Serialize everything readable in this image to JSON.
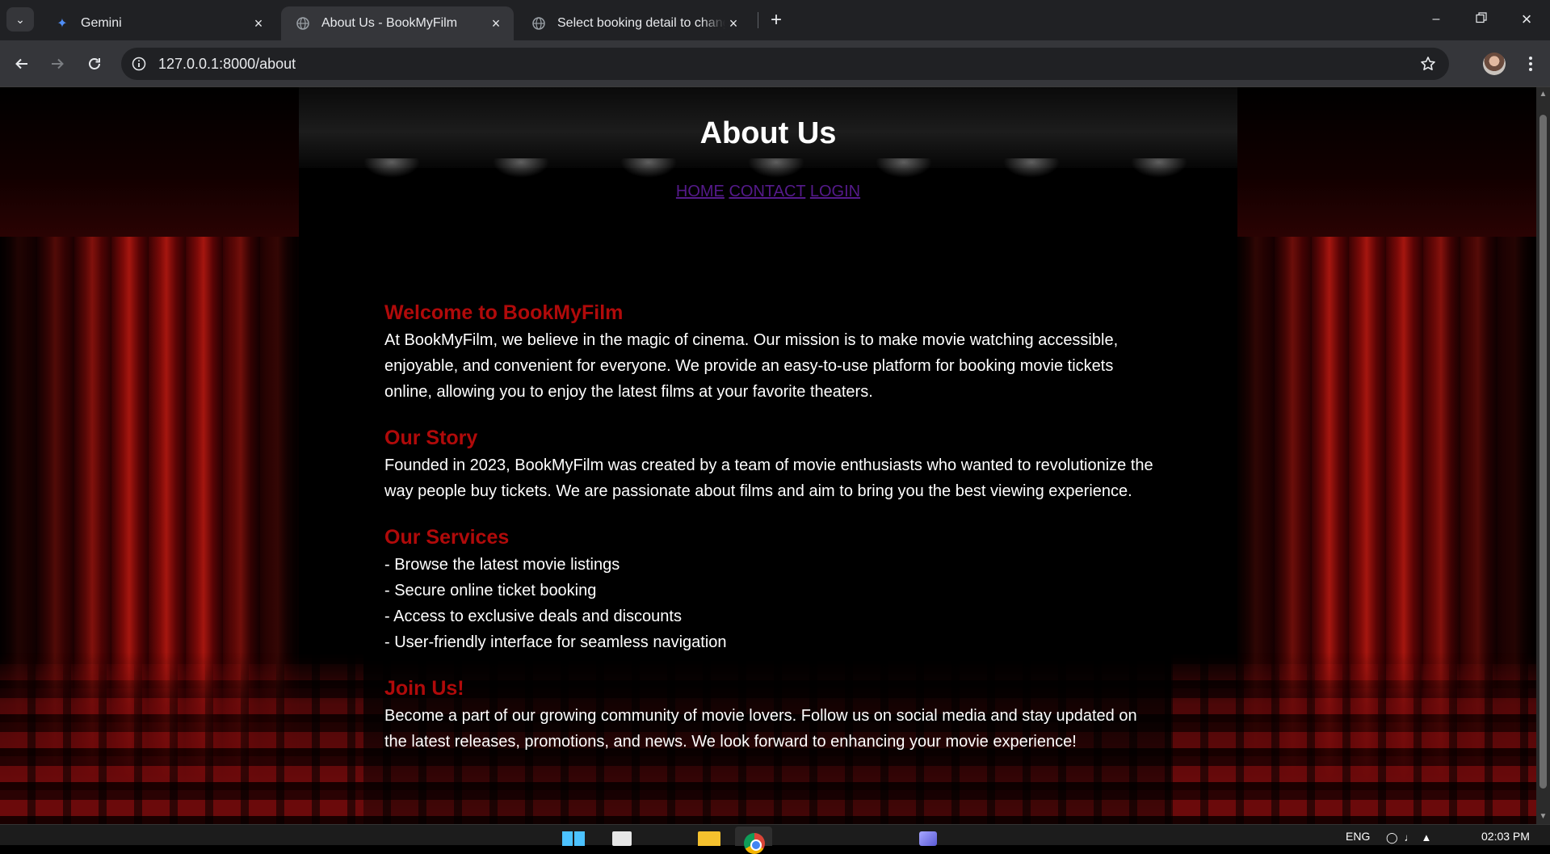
{
  "browser": {
    "tabs": [
      {
        "title": "Gemini",
        "icon": "gemini-sparkle-icon",
        "active": false
      },
      {
        "title": "About Us - BookMyFilm",
        "icon": "globe-icon",
        "active": true
      },
      {
        "title": "Select booking detail to change",
        "icon": "globe-icon",
        "active": false
      }
    ],
    "url": "127.0.0.1:8000/about"
  },
  "page": {
    "title": "About Us",
    "nav": [
      {
        "label": "HOME"
      },
      {
        "label": "CONTACT"
      },
      {
        "label": "LOGIN"
      }
    ],
    "link_color": "#551a8b",
    "heading_color": "#b00a0a",
    "sections": {
      "welcome": {
        "heading": "Welcome to BookMyFilm",
        "body": "At BookMyFilm, we believe in the magic of cinema. Our mission is to make movie watching accessible, enjoyable, and convenient for everyone. We provide an easy-to-use platform for booking movie tickets online, allowing you to enjoy the latest films at your favorite theaters."
      },
      "story": {
        "heading": "Our Story",
        "body": "Founded in 2023, BookMyFilm was created by a team of movie enthusiasts who wanted to revolutionize the way people buy tickets. We are passionate about films and aim to bring you the best viewing experience."
      },
      "services": {
        "heading": "Our Services",
        "items": [
          "- Browse the latest movie listings",
          "- Secure online ticket booking",
          "- Access to exclusive deals and discounts",
          "- User-friendly interface for seamless navigation"
        ]
      },
      "join": {
        "heading": "Join Us!",
        "body": "Become a part of our growing community of movie lovers. Follow us on social media and stay updated on the latest releases, promotions, and news. We look forward to enhancing your movie experience!"
      }
    }
  },
  "taskbar": {
    "language": "ENG",
    "time": "02:03 PM"
  }
}
